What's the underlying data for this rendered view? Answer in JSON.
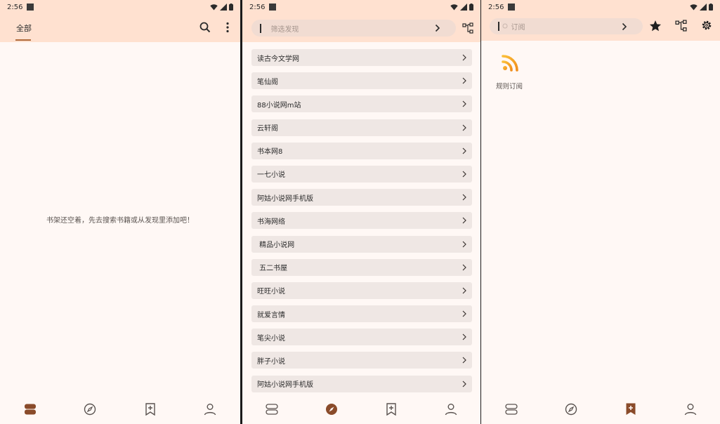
{
  "screen1": {
    "status": {
      "time": "2:56"
    },
    "tab_label": "全部",
    "empty_message": "书架还空着，先去搜索书籍或从发现里添加吧！"
  },
  "screen2": {
    "status": {
      "time": "2:56"
    },
    "search_placeholder": "筛选发现",
    "items": [
      "读古今文学网",
      "笔仙阁",
      "88小说网m站",
      "云轩阁",
      "书本网8",
      "一七小说",
      "阿姑小说网手机版",
      "书海网络",
      " 精品小说网",
      " 五二书屋",
      "旺旺小说",
      "就爱言情",
      "笔尖小说",
      "胖子小说",
      "阿姑小说网手机版"
    ]
  },
  "screen3": {
    "status": {
      "time": "2:56"
    },
    "search_placeholder": "订阅",
    "rss_label": "规则订阅"
  },
  "icons": {
    "active_nav": "bookshelf-icon",
    "accent": "#8a4b2a",
    "rss_color": "#f6a623"
  }
}
